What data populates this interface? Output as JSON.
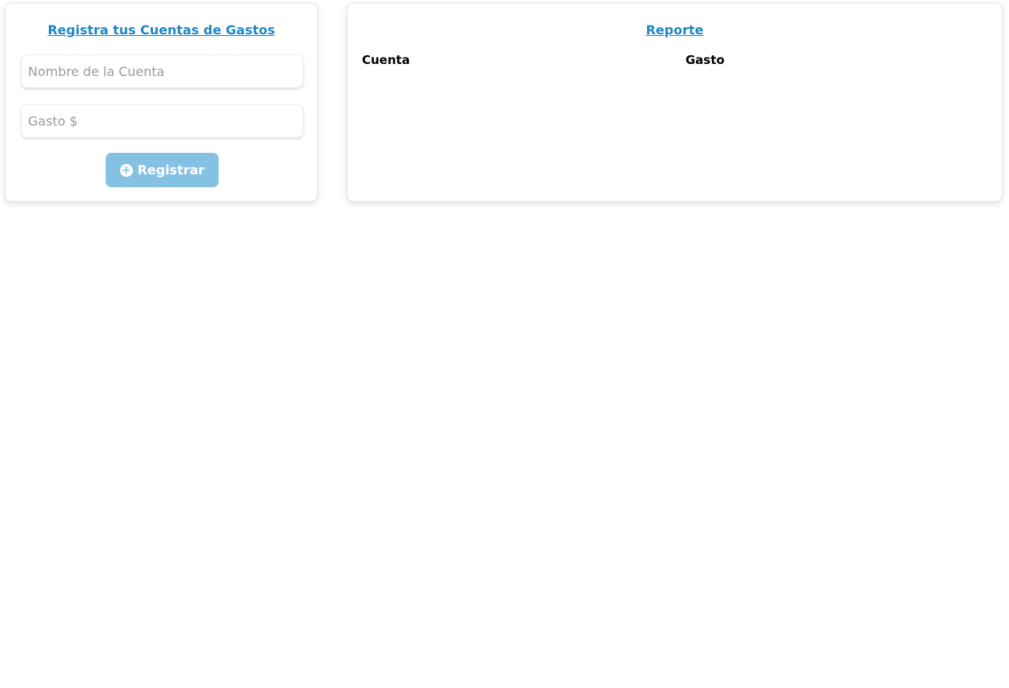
{
  "form": {
    "title": "Registra tus Cuentas de Gastos",
    "account_name_placeholder": "Nombre de la Cuenta",
    "account_name_value": "",
    "expense_placeholder": "Gasto $",
    "expense_value": "",
    "register_label": "Registrar",
    "register_icon": "plus-circle-icon"
  },
  "report": {
    "title": "Reporte",
    "columns": [
      "Cuenta",
      "Gasto"
    ],
    "rows": []
  },
  "colors": {
    "accent": "#1f86c4",
    "button": "#85c1e3"
  }
}
